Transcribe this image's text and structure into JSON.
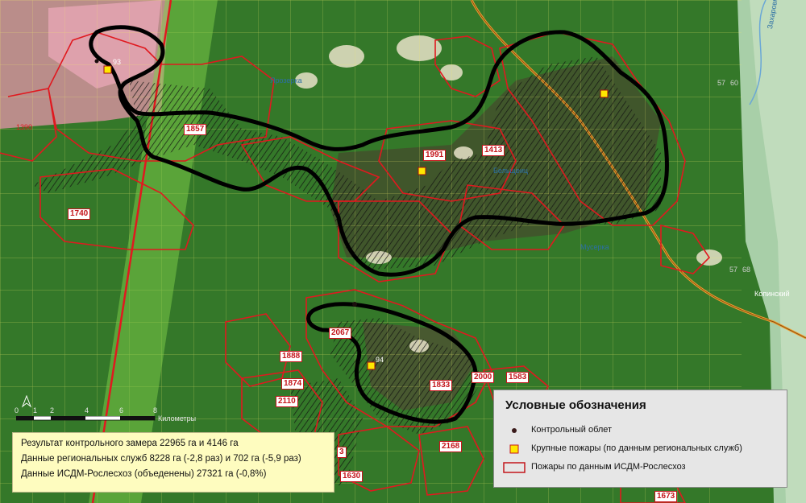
{
  "labels": {
    "info": {
      "line1": "Результат контрольного замера 22965 га и 4146 га",
      "line2": "Данные региональных служб 8228 га (-2,8 раз) и 702 га (-5,9 раз)",
      "line3": "Данные ИСДМ-Рослесхоз (объеденены) 27321 га (-0,8%)"
    },
    "legend": {
      "title": "Условные обозначения",
      "items": [
        {
          "label": "Контрольный облет"
        },
        {
          "label": "Крупные пожары (по данным региональных служб)"
        },
        {
          "label": "Пожары по данным ИСДМ-Рослесхоз"
        }
      ]
    },
    "scale": {
      "ticks": [
        "0",
        "1",
        "2",
        "4",
        "6",
        "8"
      ],
      "unit": "Километры"
    },
    "fires": [
      "1857",
      "1413",
      "1991",
      "1740",
      "2067",
      "1888",
      "1874",
      "2110",
      "1833",
      "2000",
      "1583",
      "2168",
      "1630",
      "1673",
      "3"
    ],
    "large_fires": [
      "93",
      "94"
    ],
    "places": [
      "Захаровка",
      "Копинский",
      "Ярозерка",
      "Бельщеиц",
      "Мусерка"
    ],
    "grid_numbers": [
      "1390",
      "57",
      "60",
      "57",
      "68"
    ]
  },
  "style": {
    "accent_red": "#e0191f",
    "track_black": "#000000",
    "large_fire_marker": "#ffe800",
    "legend_bg": "#e6e6e6",
    "info_bg": "#fefcbf"
  }
}
